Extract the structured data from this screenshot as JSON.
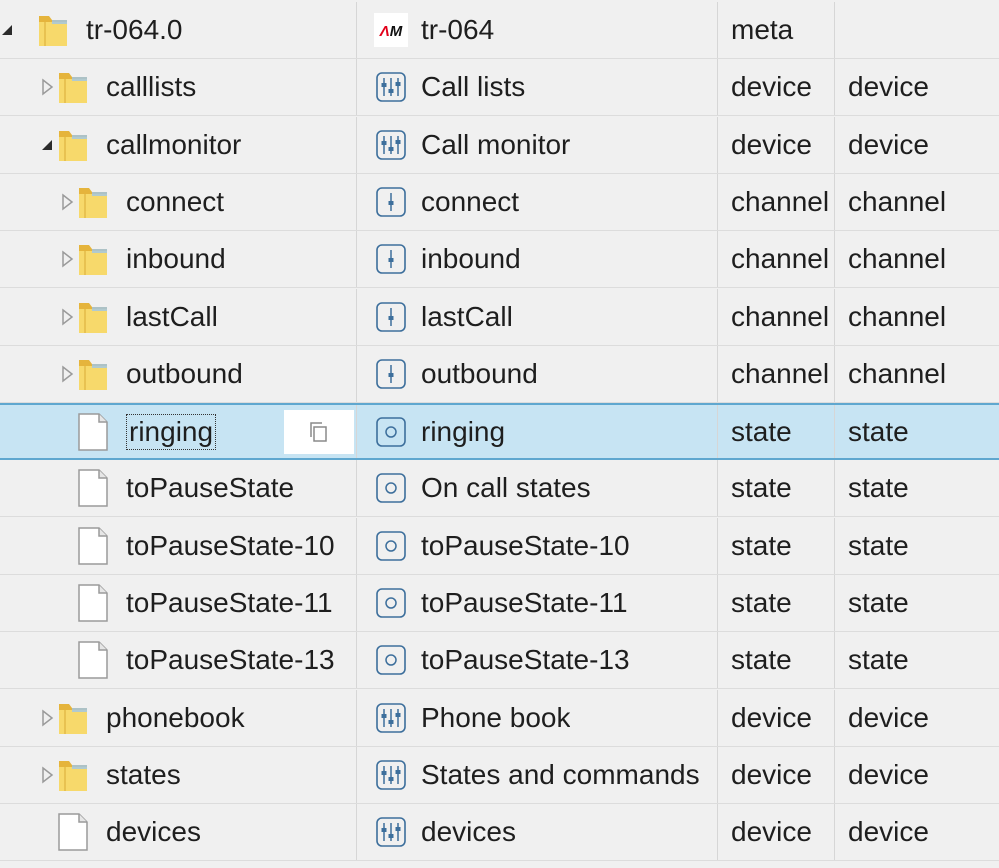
{
  "rows": [
    {
      "name": "tr-064.0",
      "desc": "tr-064",
      "type": "meta",
      "role": "",
      "depth": 0,
      "toggle": "expanded",
      "icon": "folder-icon",
      "desc_icon": "avm-logo-icon"
    },
    {
      "name": "calllists",
      "desc": "Call lists",
      "type": "device",
      "role": "device",
      "depth": 1,
      "toggle": "collapsed",
      "icon": "folder-icon",
      "desc_icon": "device-sliders-icon"
    },
    {
      "name": "callmonitor",
      "desc": "Call monitor",
      "type": "device",
      "role": "device",
      "depth": 1,
      "toggle": "expanded",
      "icon": "folder-icon",
      "desc_icon": "device-sliders-icon"
    },
    {
      "name": "connect",
      "desc": "connect",
      "type": "channel",
      "role": "channel",
      "depth": 2,
      "toggle": "collapsed",
      "icon": "folder-icon",
      "desc_icon": "channel-icon"
    },
    {
      "name": "inbound",
      "desc": "inbound",
      "type": "channel",
      "role": "channel",
      "depth": 2,
      "toggle": "collapsed",
      "icon": "folder-icon",
      "desc_icon": "channel-icon"
    },
    {
      "name": "lastCall",
      "desc": "lastCall",
      "type": "channel",
      "role": "channel",
      "depth": 2,
      "toggle": "collapsed",
      "icon": "folder-icon",
      "desc_icon": "channel-icon"
    },
    {
      "name": "outbound",
      "desc": "outbound",
      "type": "channel",
      "role": "channel",
      "depth": 2,
      "toggle": "collapsed",
      "icon": "folder-icon",
      "desc_icon": "channel-icon"
    },
    {
      "name": "ringing",
      "desc": "ringing",
      "type": "state",
      "role": "state",
      "depth": 2,
      "toggle": "none",
      "icon": "file-icon",
      "desc_icon": "state-icon",
      "selected": true
    },
    {
      "name": "toPauseState",
      "desc": "On call states",
      "type": "state",
      "role": "state",
      "depth": 2,
      "toggle": "none",
      "icon": "file-icon",
      "desc_icon": "state-icon"
    },
    {
      "name": "toPauseState-10",
      "desc": "toPauseState-10",
      "type": "state",
      "role": "state",
      "depth": 2,
      "toggle": "none",
      "icon": "file-icon",
      "desc_icon": "state-icon"
    },
    {
      "name": "toPauseState-11",
      "desc": "toPauseState-11",
      "type": "state",
      "role": "state",
      "depth": 2,
      "toggle": "none",
      "icon": "file-icon",
      "desc_icon": "state-icon"
    },
    {
      "name": "toPauseState-13",
      "desc": "toPauseState-13",
      "type": "state",
      "role": "state",
      "depth": 2,
      "toggle": "none",
      "icon": "file-icon",
      "desc_icon": "state-icon"
    },
    {
      "name": "phonebook",
      "desc": "Phone book",
      "type": "device",
      "role": "device",
      "depth": 1,
      "toggle": "collapsed",
      "icon": "folder-icon",
      "desc_icon": "device-sliders-icon"
    },
    {
      "name": "states",
      "desc": "States and commands",
      "type": "device",
      "role": "device",
      "depth": 1,
      "toggle": "collapsed",
      "icon": "folder-icon",
      "desc_icon": "device-sliders-icon"
    },
    {
      "name": "devices",
      "desc": "devices",
      "type": "device",
      "role": "device",
      "depth": 1,
      "toggle": "none",
      "icon": "file-icon",
      "desc_icon": "device-sliders-icon"
    }
  ],
  "copy_button": {
    "icon": "copy-icon"
  },
  "colors": {
    "selected_bg": "#c7e4f3",
    "selected_border": "#5fa7cf",
    "icon_blue": "#3d6f9c",
    "folder_yellow": "#f2cd5c"
  }
}
